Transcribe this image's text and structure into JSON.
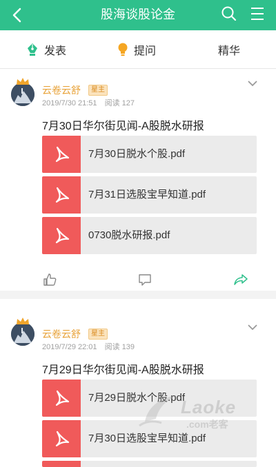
{
  "header": {
    "title": "股海谈股论金",
    "back_icon": "back-arrow-icon",
    "search_icon": "search-icon",
    "menu_icon": "hamburger-menu-icon",
    "bg_color": "#2fc08c"
  },
  "subnav": {
    "items": [
      {
        "label": "发表",
        "icon": "pen-nib-icon"
      },
      {
        "label": "提问",
        "icon": "lightbulb-icon"
      },
      {
        "label": "精华"
      }
    ]
  },
  "posts": [
    {
      "author": "云卷云舒",
      "badge": "星主",
      "date": "2019/7/30 21:51",
      "reads": "阅读 127",
      "title": "7月30日华尔街见闻-A股脱水研报",
      "files": [
        "7月30日脱水个股.pdf",
        "7月31日选股宝早知道.pdf",
        "0730脱水研报.pdf"
      ]
    },
    {
      "author": "云卷云舒",
      "badge": "星主",
      "date": "2019/7/29 22:01",
      "reads": "阅读 139",
      "title": "7月29日华尔街见闻-A股脱水研报",
      "files": [
        "7月29日脱水个股.pdf",
        "7月30日选股宝早知道.pdf"
      ]
    }
  ],
  "watermark": {
    "id_text": "5111512541854",
    "brand": "Laoke",
    "brand_sub": ".com老客"
  },
  "colors": {
    "accent_green": "#2fc08c",
    "pdf_red": "#f05a5a",
    "author_orange": "#e8a33a"
  }
}
